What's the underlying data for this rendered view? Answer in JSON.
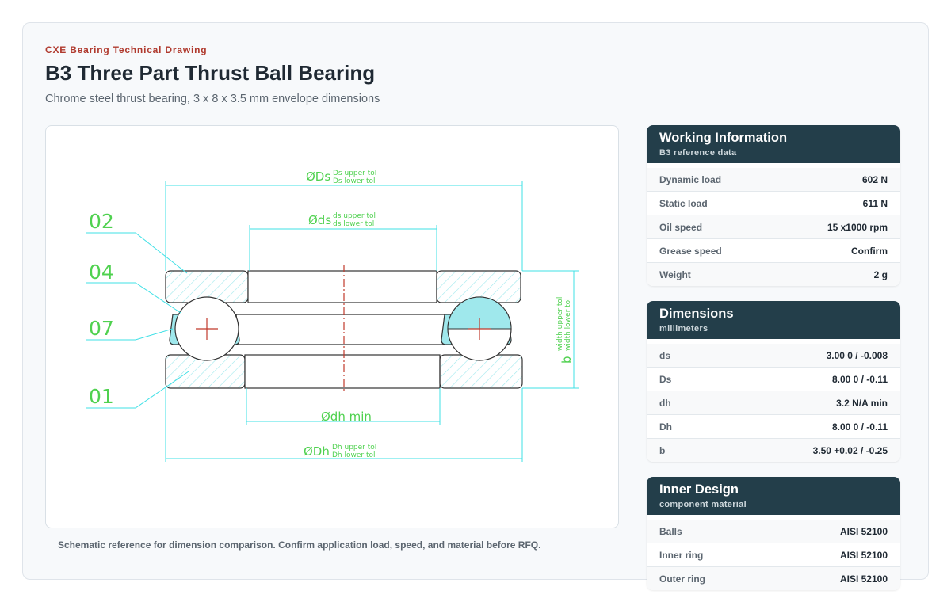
{
  "header": {
    "eyebrow": "CXE Bearing Technical Drawing",
    "title": "B3 Three Part Thrust Ball Bearing",
    "subtitle": "Chrome steel thrust bearing, 3 x 8 x 3.5 mm envelope dimensions"
  },
  "drawing": {
    "callouts": [
      "02",
      "04",
      "07",
      "01"
    ],
    "dim_Ds": {
      "main": "ØDs",
      "upper": "Ds upper tol",
      "lower": "Ds lower tol"
    },
    "dim_ds": {
      "main": "Øds",
      "upper": "ds upper tol",
      "lower": "ds lower tol"
    },
    "dim_dh": {
      "main": "Ødh min"
    },
    "dim_Dh": {
      "main": "ØDh",
      "upper": "Dh upper tol",
      "lower": "Dh lower tol"
    },
    "dim_b": {
      "main": "b",
      "upper": "width upper tol",
      "lower": "width lower tol"
    },
    "colors": {
      "dimension": "#3fe0e6",
      "label": "#4fd14f",
      "outline": "#333333",
      "center": "#c0392b",
      "hatch": "#9fe8ec"
    }
  },
  "caption": "Schematic reference for dimension comparison. Confirm application load, speed, and material before RFQ.",
  "working": {
    "title": "Working Information",
    "subtitle": "B3 reference data",
    "rows": [
      {
        "label": "Dynamic load",
        "value": "602 N"
      },
      {
        "label": "Static load",
        "value": "611 N"
      },
      {
        "label": "Oil speed",
        "value": "15 x1000 rpm"
      },
      {
        "label": "Grease speed",
        "value": "Confirm"
      },
      {
        "label": "Weight",
        "value": "2 g"
      }
    ]
  },
  "dimensions": {
    "title": "Dimensions",
    "subtitle": "millimeters",
    "rows": [
      {
        "label": "ds",
        "value": "3.00 0 / -0.008"
      },
      {
        "label": "Ds",
        "value": "8.00 0 / -0.11"
      },
      {
        "label": "dh",
        "value": "3.2 N/A min"
      },
      {
        "label": "Dh",
        "value": "8.00 0 / -0.11"
      },
      {
        "label": "b",
        "value": "3.50 +0.02 / -0.25"
      }
    ]
  },
  "inner_design": {
    "title": "Inner Design",
    "subtitle": "component material",
    "rows": [
      {
        "label": "Balls",
        "value": "AISI 52100"
      },
      {
        "label": "Inner ring",
        "value": "AISI 52100"
      },
      {
        "label": "Outer ring",
        "value": "AISI 52100"
      }
    ]
  }
}
